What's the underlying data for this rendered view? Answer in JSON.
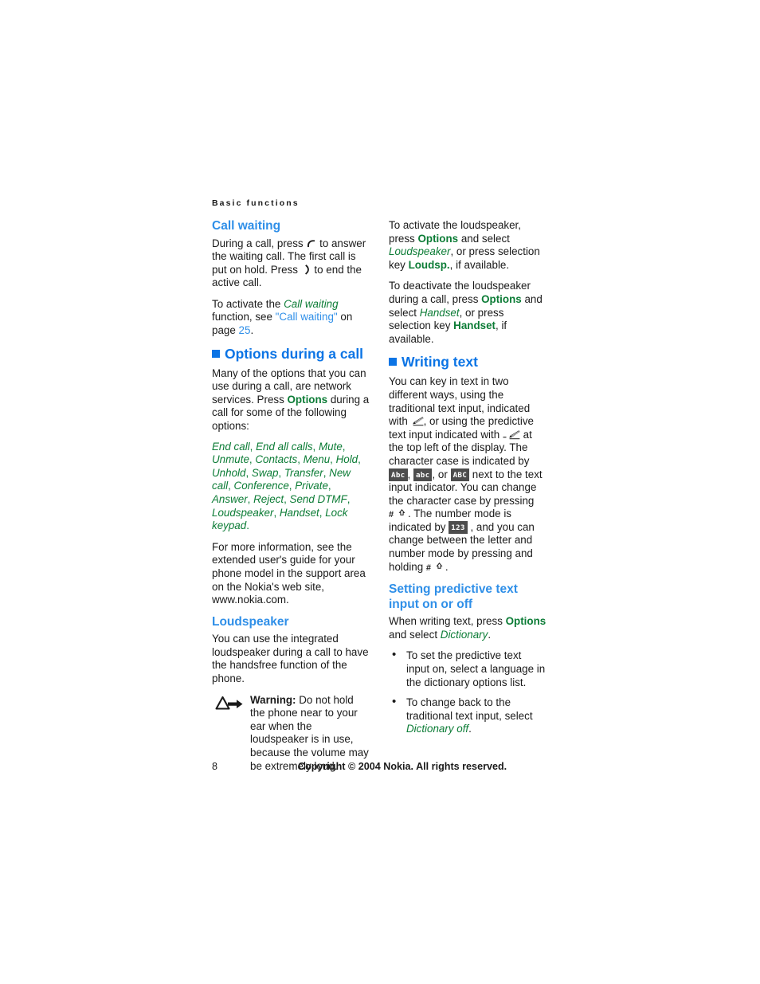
{
  "document": {
    "running_head": "Basic functions",
    "page_number": "8",
    "copyright": "Copyright © 2004 Nokia. All rights reserved.",
    "colors": {
      "heading_blue": "#0b74e5",
      "subheading_blue": "#2f8fe8",
      "accent_green": "#0c7c36",
      "text": "#1a1a1a",
      "badge_bg": "#4d4d4d"
    }
  },
  "left_column": {
    "call_waiting": {
      "heading": "Call waiting",
      "para1_a": "During a call, press",
      "para1_b": "to answer the waiting call. The first call is put on hold. Press",
      "para1_c": "to end the active call.",
      "para2_a": "To activate the",
      "para2_italic": "Call waiting",
      "para2_b": "function, see",
      "para2_link": "\"Call waiting\"",
      "para2_c": "on page",
      "para2_page": "25",
      "para2_d": "."
    },
    "options_during_call": {
      "heading": "Options during a call",
      "para1_a": "Many of the options that you can use during a call, are network services. Press",
      "para1_bold": "Options",
      "para1_b": "during a call for some of the following options:",
      "options": [
        "End call",
        "End all calls",
        "Mute",
        "Unmute",
        "Contacts",
        "Menu",
        "Hold",
        "Unhold",
        "Swap",
        "Transfer",
        "New call",
        "Conference",
        "Private",
        "Answer",
        "Reject",
        "Send DTMF",
        "Loudspeaker",
        "Handset",
        "Lock keypad"
      ],
      "para2": "For more information, see the extended user's guide for your phone model in the support area on the Nokia's web site, www.nokia.com."
    },
    "loudspeaker": {
      "heading": "Loudspeaker",
      "para1": "You can use the integrated loudspeaker during a call to have the handsfree function of the phone.",
      "warning_label": "Warning:",
      "warning_text": "Do not hold the phone near to your ear when the loudspeaker is in use, because the volume may be extremely loud."
    }
  },
  "right_column": {
    "loudspeaker_cont": {
      "para1_a": "To activate the loudspeaker, press",
      "para1_bold1": "Options",
      "para1_b": "and select",
      "para1_italic": "Loudspeaker",
      "para1_c": ", or press selection key",
      "para1_bold2": "Loudsp.",
      "para1_d": ", if available.",
      "para2_a": "To deactivate the loudspeaker during a call, press",
      "para2_bold1": "Options",
      "para2_b": "and select",
      "para2_italic": "Handset",
      "para2_c": ", or press selection key",
      "para2_bold2": "Handset",
      "para2_d": ", if available."
    },
    "writing_text": {
      "heading": "Writing text",
      "para_a": "You can key in text in two different ways, using the traditional text input, indicated with",
      "para_b": ", or using the predictive text input indicated with",
      "para_c": "at the top left of the display. The character case is indicated by",
      "badge_abc_upper": "Abc",
      "badge_abc_lower": "abc",
      "badge_abc_caps": "ABC",
      "para_d": "next to the text input indicator. You can change the character case by pressing",
      "para_e": ". The number mode is indicated by",
      "badge_123": "123",
      "para_f": ", and you can change between the letter and number mode by pressing and holding",
      "para_g": "."
    },
    "predictive": {
      "heading": "Setting predictive text input on or off",
      "para_a": "When writing text, press",
      "para_bold": "Options",
      "para_b": "and select",
      "para_italic": "Dictionary",
      "para_c": ".",
      "bullets": [
        {
          "text": "To set the predictive text input on, select a language in the dictionary options list."
        },
        {
          "prefix": "To change back to the traditional text input, select",
          "italic": "Dictionary off",
          "suffix": "."
        }
      ]
    }
  },
  "icons": {
    "call_key": "call-key-icon",
    "end_call_key": "end-call-key-icon",
    "warning": "warning-triangle-icon",
    "traditional_input": "pencil-icon",
    "predictive_input": "predictive-pencil-icon",
    "shift_key": "hash-shift-key-icon"
  }
}
